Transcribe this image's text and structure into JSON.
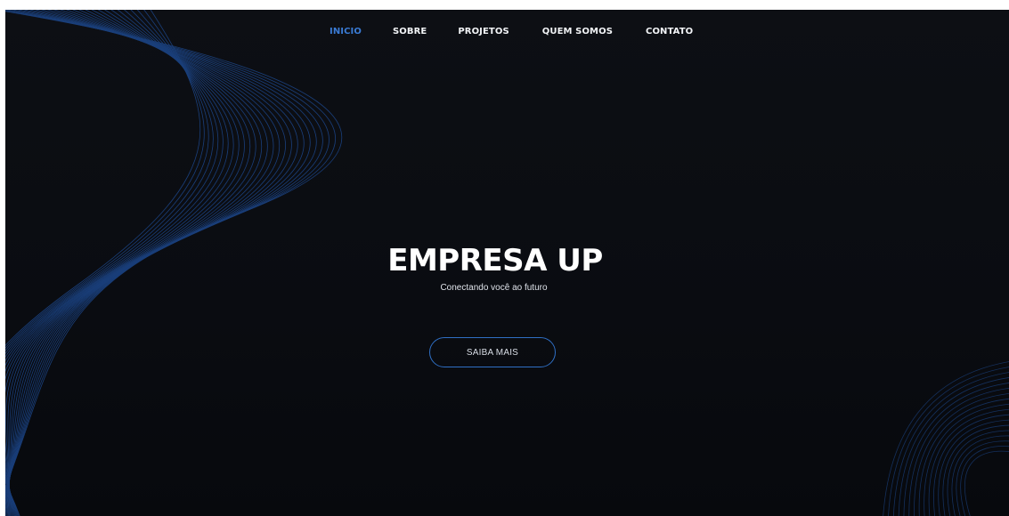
{
  "nav": {
    "items": [
      {
        "label": "INICIO",
        "active": true
      },
      {
        "label": "SOBRE",
        "active": false
      },
      {
        "label": "PROJETOS",
        "active": false
      },
      {
        "label": "QUEM SOMOS",
        "active": false
      },
      {
        "label": "CONTATO",
        "active": false
      }
    ]
  },
  "hero": {
    "title": "EMPRESA UP",
    "subtitle": "Conectando você ao futuro",
    "cta_label": "SAIBA MAIS"
  },
  "colors": {
    "background": "#0b0d12",
    "accent": "#3a7bd5",
    "wave_line": "#1f4f9c",
    "text": "#ffffff"
  }
}
